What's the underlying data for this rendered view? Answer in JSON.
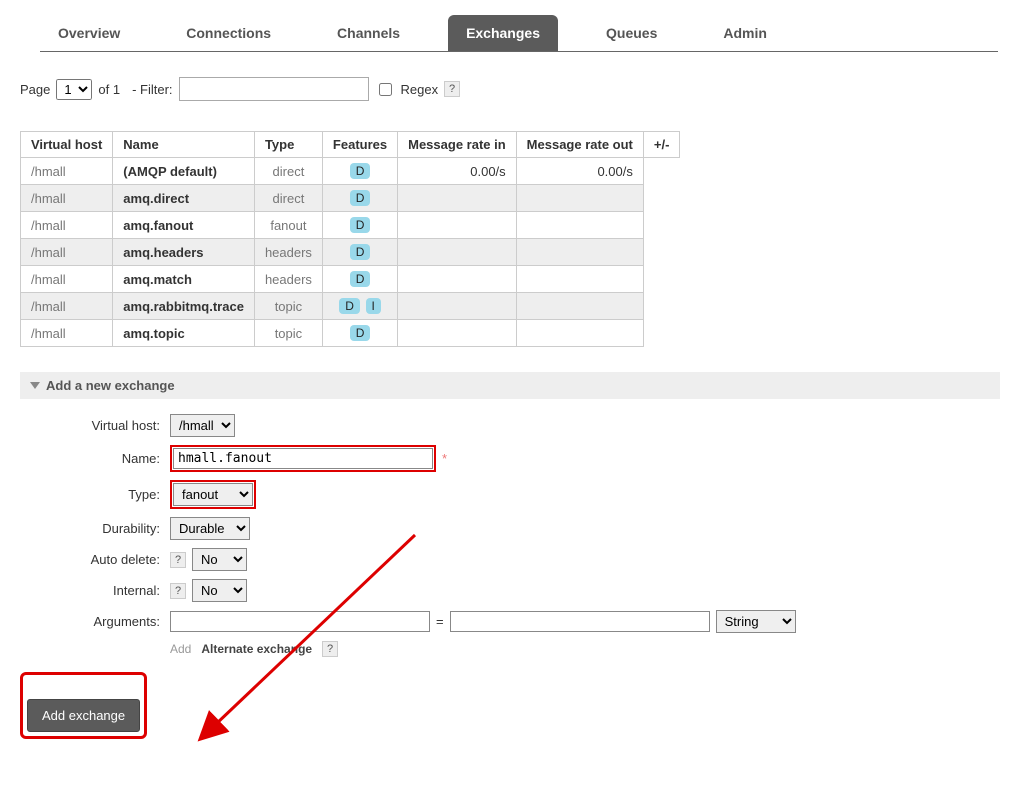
{
  "tabs": {
    "overview": "Overview",
    "connections": "Connections",
    "channels": "Channels",
    "exchanges": "Exchanges",
    "queues": "Queues",
    "admin": "Admin",
    "active": "exchanges"
  },
  "pagebar": {
    "page_label": "Page",
    "page_value": "1",
    "of_label": "of 1",
    "filter_label": "- Filter:",
    "filter_value": "",
    "regex_label": "Regex",
    "regex_checked": false
  },
  "table": {
    "headers": {
      "vhost": "Virtual host",
      "name": "Name",
      "type": "Type",
      "features": "Features",
      "rate_in": "Message rate in",
      "rate_out": "Message rate out",
      "pm": "+/-"
    },
    "rows": [
      {
        "vhost": "/hmall",
        "name": "(AMQP default)",
        "type": "direct",
        "features": [
          "D"
        ],
        "in": "0.00/s",
        "out": "0.00/s"
      },
      {
        "vhost": "/hmall",
        "name": "amq.direct",
        "type": "direct",
        "features": [
          "D"
        ],
        "in": "",
        "out": ""
      },
      {
        "vhost": "/hmall",
        "name": "amq.fanout",
        "type": "fanout",
        "features": [
          "D"
        ],
        "in": "",
        "out": ""
      },
      {
        "vhost": "/hmall",
        "name": "amq.headers",
        "type": "headers",
        "features": [
          "D"
        ],
        "in": "",
        "out": ""
      },
      {
        "vhost": "/hmall",
        "name": "amq.match",
        "type": "headers",
        "features": [
          "D"
        ],
        "in": "",
        "out": ""
      },
      {
        "vhost": "/hmall",
        "name": "amq.rabbitmq.trace",
        "type": "topic",
        "features": [
          "D",
          "I"
        ],
        "in": "",
        "out": ""
      },
      {
        "vhost": "/hmall",
        "name": "amq.topic",
        "type": "topic",
        "features": [
          "D"
        ],
        "in": "",
        "out": ""
      }
    ]
  },
  "section": {
    "title": "Add a new exchange"
  },
  "form": {
    "vhost_label": "Virtual host:",
    "vhost_value": "/hmall",
    "name_label": "Name:",
    "name_value": "hmall.fanout",
    "type_label": "Type:",
    "type_value": "fanout",
    "durability_label": "Durability:",
    "durability_value": "Durable",
    "auto_delete_label": "Auto delete:",
    "auto_delete_value": "No",
    "internal_label": "Internal:",
    "internal_value": "No",
    "arguments_label": "Arguments:",
    "arg_key": "",
    "arg_val": "",
    "arg_type": "String",
    "add_label": "Add",
    "alt_exchange_label": "Alternate exchange",
    "submit_label": "Add exchange"
  }
}
